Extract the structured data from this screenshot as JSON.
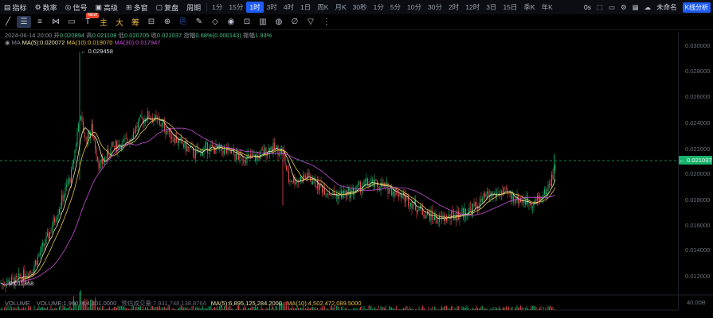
{
  "topbar": {
    "left_items": [
      {
        "icon": "chart-icon",
        "label": "指标"
      },
      {
        "icon": "dataset-icon",
        "label": "数率"
      },
      {
        "icon": "signal-icon",
        "label": "信号"
      },
      {
        "icon": "advanced-icon",
        "label": "高级"
      },
      {
        "icon": "grid-icon",
        "label": "多窗"
      },
      {
        "icon": "replay-icon",
        "label": "复盘"
      },
      {
        "icon": "",
        "label": "周期"
      }
    ],
    "timeframes": [
      "1分",
      "15分",
      "1时",
      "3时",
      "4时",
      "1日",
      "周K",
      "月K",
      "30秒",
      "1分",
      "5分",
      "10分",
      "30分",
      "2时",
      "12时",
      "3日",
      "15日",
      "季K",
      "年K"
    ],
    "active_timeframe_index": 2,
    "right": {
      "zero_s": "0s",
      "unnamed": "未命名",
      "analysis_button": "K线分析"
    }
  },
  "drawing_tools": {
    "labels": {
      "zhu": "主",
      "da": "大",
      "chou": "筹"
    },
    "new_badge": "NEW"
  },
  "ohlc": {
    "date": "2024-06-14 20:00",
    "open_label": "开",
    "open": "0.020894",
    "high_label": "高",
    "high": "0.021108",
    "low_label": "低",
    "low": "0.020705",
    "close_label": "收",
    "close": "0.021037",
    "change_label": "涨幅",
    "change": "0.68%(0.000143)",
    "amp_label": "振幅",
    "amp": "1.93%"
  },
  "ma": {
    "label": "MA",
    "ma5": "MA(5):0.020072",
    "ma10": "MA(10):0.019070",
    "ma30": "MA(30):0.017947"
  },
  "volume": {
    "label": "VOLUME",
    "volume": "VOLUME:1,960,904,401.0000",
    "forecast": "预估成交量:7,931,748,138.8764",
    "ma5": "MA(5):6,895,125,284.2000",
    "ma10": "MA(10):4,502,472,089.5000",
    "axis_label": "40.00B"
  },
  "y_axis": {
    "ticks": [
      "0.030000",
      "0.028000",
      "0.026000",
      "0.024000",
      "0.022000",
      "0.020000",
      "0.018000",
      "0.016000",
      "0.014000",
      "0.012000"
    ],
    "current_price": "0.021037"
  },
  "annotations": {
    "high": "0.029458",
    "low": "0.011368"
  },
  "colors": {
    "up": "#17b26a",
    "down": "#e5484d",
    "ma5": "#f0e7b0",
    "ma10": "#e6c148",
    "ma30": "#c64fd6",
    "accent": "#1f5cf5"
  }
}
